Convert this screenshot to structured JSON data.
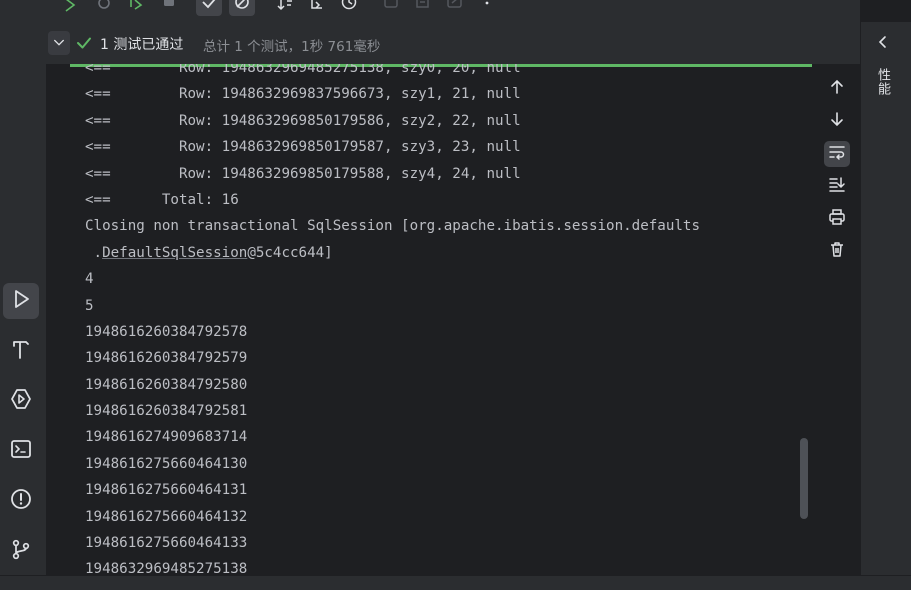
{
  "status": {
    "passed_label": "1 测试已通过",
    "summary": "总计 1 个测试，1秒 761毫秒"
  },
  "console": {
    "lines": [
      "<==        Row: 1948632969485275138, szy0, 20, null",
      "<==        Row: 1948632969837596673, szy1, 21, null",
      "<==        Row: 1948632969850179586, szy2, 22, null",
      "<==        Row: 1948632969850179587, szy3, 23, null",
      "<==        Row: 1948632969850179588, szy4, 24, null",
      "<==      Total: 16",
      "Closing non transactional SqlSession [org.apache.ibatis.session.defaults",
      "4",
      "5",
      "1948616260384792578",
      "1948616260384792579",
      "1948616260384792580",
      "1948616260384792581",
      "1948616274909683714",
      "1948616275660464130",
      "1948616275660464131",
      "1948616275660464132",
      "1948616275660464133",
      "1948632969485275138"
    ],
    "wrap_prefix": " .",
    "wrap_link": "DefaultSqlSession",
    "wrap_suffix": "@5c4cc644]"
  },
  "right_rail": {
    "label": "性能"
  },
  "icons": {
    "left": [
      "run-icon",
      "build-hammer-icon",
      "services-icon",
      "terminal-icon",
      "problems-icon",
      "git-icon"
    ],
    "toolbar": [
      "rerun-icon",
      "rerun-failed-icon",
      "rerun-auto-icon",
      "stop-icon",
      "show-passed-icon",
      "show-ignored-icon",
      "sort-icon",
      "import-icon",
      "history-icon",
      "export-icon",
      "more-icon"
    ],
    "actions": [
      "scroll-up-icon",
      "scroll-down-icon",
      "soft-wrap-icon",
      "scroll-to-end-icon",
      "print-icon",
      "clear-icon"
    ]
  },
  "colors": {
    "accent_green": "#5fb865",
    "panel": "#2b2d30",
    "editor": "#1e1f22",
    "text": "#bcbec4"
  }
}
